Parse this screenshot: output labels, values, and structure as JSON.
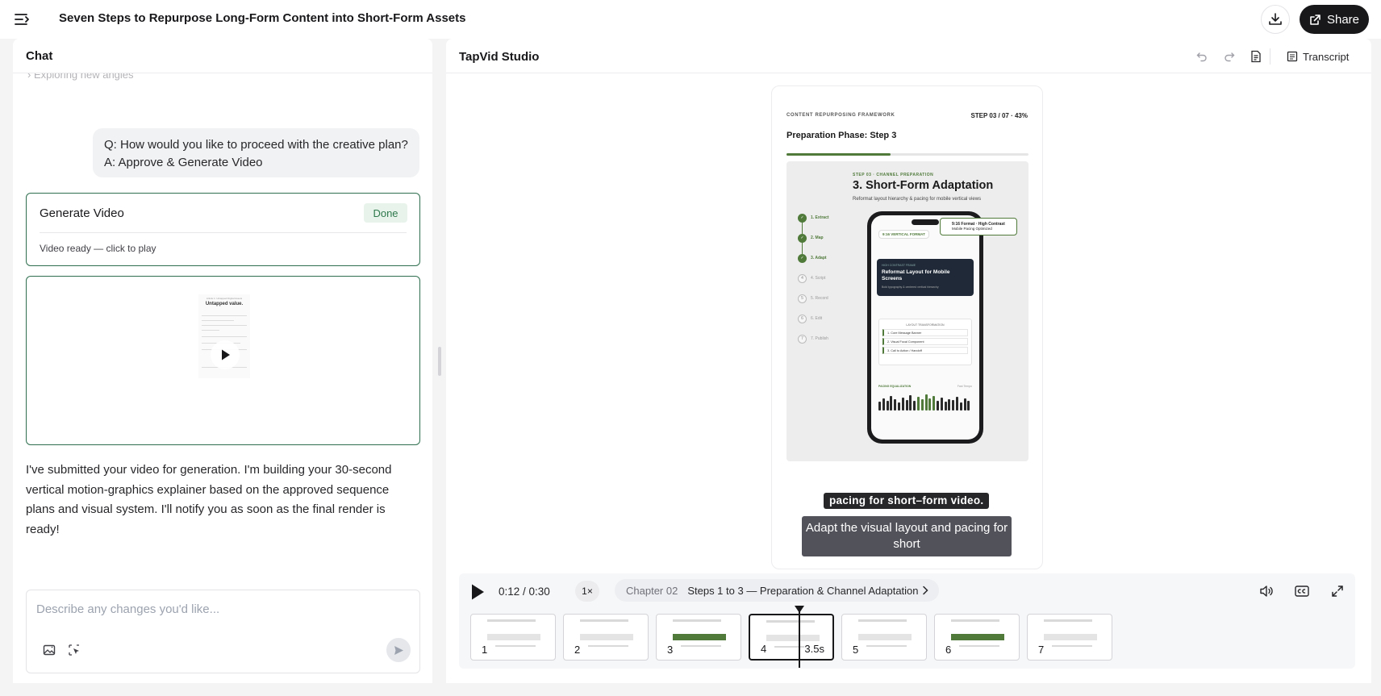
{
  "topbar": {
    "title": "Seven Steps to Repurpose Long-Form Content into Short-Form Assets",
    "share_label": "Share"
  },
  "chat": {
    "header": "Chat",
    "faded_text": "Exploring new angles",
    "qa": {
      "question": "Q: How would you like to proceed with the creative plan?",
      "answer": "A: Approve & Generate Video"
    },
    "generate_card": {
      "title": "Generate Video",
      "badge": "Done",
      "status": "Video ready — click to play"
    },
    "video_thumb": {
      "caption": "Article 1: Untapped Digital Assets",
      "title": "Untapped value."
    },
    "assistant_message": "I've submitted your video for generation. I'm building your 30-second vertical motion-graphics explainer based on the approved sequence plans and visual system. I'll notify you as soon as the final render is ready!",
    "composer": {
      "placeholder": "Describe any changes you'd like..."
    }
  },
  "studio": {
    "title": "TapVid Studio",
    "transcript_label": "Transcript",
    "slide": {
      "caption": "CONTENT REPURPOSING FRAMEWORK",
      "step": "STEP 03 / 07 · 43%",
      "heading": "Preparation Phase: Step 3",
      "progress": 0.43,
      "kicker": "STEP 03 · CHANNEL PREPARATION",
      "title": "3. Short-Form Adaptation",
      "subtitle": "Reformat layout hierarchy & pacing for mobile vertical views",
      "steps": [
        {
          "num": "1",
          "label": "1. Extract",
          "done": true
        },
        {
          "num": "2",
          "label": "2. Map",
          "done": true
        },
        {
          "num": "3",
          "label": "3. Adapt",
          "done": true
        },
        {
          "num": "4",
          "label": "4. Script",
          "done": false
        },
        {
          "num": "5",
          "label": "5. Record",
          "done": false
        },
        {
          "num": "6",
          "label": "6. Edit",
          "done": false
        },
        {
          "num": "7",
          "label": "7. Publish",
          "done": false
        }
      ],
      "phone": {
        "tag": "9:16 VERTICAL FORMAT",
        "float_title": "9:16 Format · High Contrast",
        "float_sub": "Mobile Pacing Optimized",
        "card_kicker": "HIGH CONTRAST FRAME",
        "card_title": "Reformat Layout for Mobile Screens",
        "card_sub": "Bold typography & centered vertical hierarchy",
        "layout_heading": "LAYOUT TRANSFORMATION",
        "layout_items": [
          "1. Core Message Banner",
          "2. Visual Focal Component",
          "3. Call to Action / Handoff"
        ],
        "pacing_label": "PACING EQUALIZATION",
        "pacing_right": "Fast Tempo",
        "bars": [
          0.55,
          0.75,
          0.6,
          0.9,
          0.7,
          0.5,
          0.8,
          0.65,
          0.95,
          0.6,
          0.85,
          0.7,
          1.0,
          0.75,
          0.9,
          0.6,
          0.8,
          0.55,
          0.7,
          0.65,
          0.85,
          0.5,
          0.75,
          0.6
        ]
      }
    },
    "subtitle_chip": "pacing for short–form video.",
    "caption": "Adapt the visual layout and pacing for short",
    "player": {
      "timecode": "0:12 / 0:30",
      "speed": "1×",
      "chapter_label": "Chapter 02",
      "chapter_title": "Steps 1 to 3 — Preparation & Channel Adaptation"
    },
    "frames": [
      {
        "num": "1",
        "dur": ""
      },
      {
        "num": "2",
        "dur": ""
      },
      {
        "num": "3",
        "dur": ""
      },
      {
        "num": "4",
        "dur": "3.5s"
      },
      {
        "num": "5",
        "dur": ""
      },
      {
        "num": "6",
        "dur": ""
      },
      {
        "num": "7",
        "dur": ""
      }
    ]
  },
  "colors": {
    "accent_green": "#4f7a3a",
    "card_border": "#2f6f4f",
    "done_badge_bg": "#e8f3ec",
    "dark": "#18181b"
  }
}
